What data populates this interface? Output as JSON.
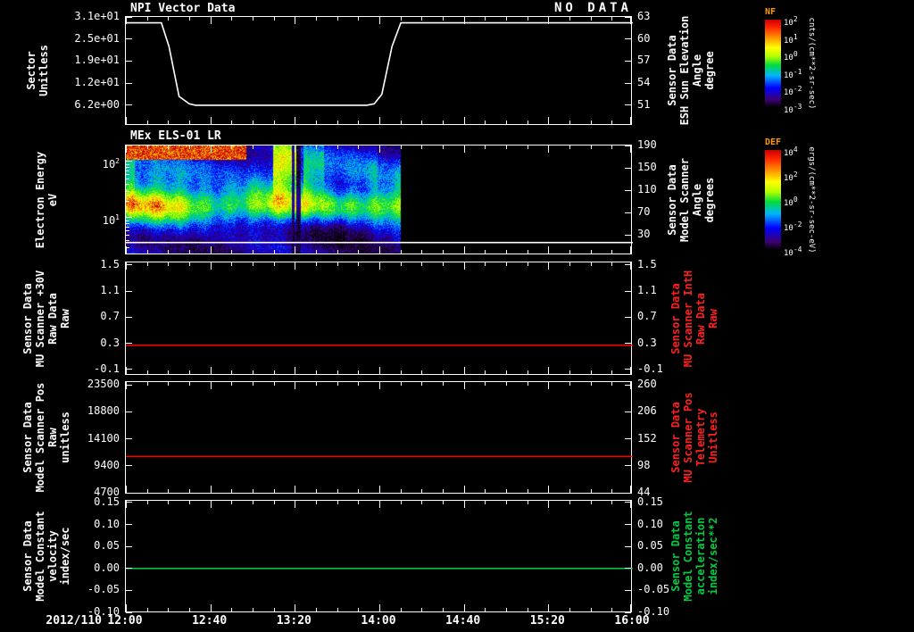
{
  "colors": {
    "background": "#000000",
    "foreground": "#ffffff",
    "line_red": "#ff0000",
    "line_green": "#00c040",
    "right_label_red": "#ff2020",
    "right_label_green": "#00cc44",
    "colorbar_title": "#ff9900"
  },
  "header": {
    "title": "NPI Vector Data",
    "no_data": "NO DATA"
  },
  "panel2_title": "MEx ELS-01 LR",
  "time_axis": {
    "date": "2012/110",
    "start_hour": 12,
    "end_hour": 16,
    "major_labels": [
      "12:00",
      "12:40",
      "13:20",
      "14:00",
      "14:40",
      "15:20",
      "16:00"
    ],
    "minor_step_minutes": 10
  },
  "chart_data": [
    {
      "type": "line",
      "name": "npi-vector-data",
      "title": "NPI Vector Data",
      "status": "NO DATA",
      "axis": {
        "top_value": 63,
        "bottom_value": 48.2
      },
      "left_label_lines": [
        "Sector",
        "Unitless"
      ],
      "left_ticks": [
        {
          "label": "3.1e+01",
          "at": 63
        },
        {
          "label": "2.5e+01",
          "at": 60
        },
        {
          "label": "1.9e+01",
          "at": 57
        },
        {
          "label": "1.2e+01",
          "at": 54
        },
        {
          "label": "6.2e+00",
          "at": 51
        }
      ],
      "right_ticks": [
        {
          "label": "63",
          "at": 63
        },
        {
          "label": "60",
          "at": 60
        },
        {
          "label": "57",
          "at": 57
        },
        {
          "label": "54",
          "at": 54
        },
        {
          "label": "51",
          "at": 51
        }
      ],
      "right_label_lines": [
        "Sensor Data",
        "ESH Sun Elevation",
        "Angle",
        "degree"
      ],
      "right_label_color": "#ffffff",
      "lines": [
        {
          "series": "ESH Sun Elevation Angle (degrees)",
          "color": "#ffffff",
          "points": [
            [
              12.0,
              62.2
            ],
            [
              12.28,
              62.2
            ],
            [
              12.34,
              59.0
            ],
            [
              12.42,
              52.2
            ],
            [
              12.5,
              51.2
            ],
            [
              12.55,
              51.0
            ],
            [
              13.9,
              51.0
            ],
            [
              13.96,
              51.2
            ],
            [
              14.02,
              52.5
            ],
            [
              14.1,
              59.0
            ],
            [
              14.17,
              62.2
            ],
            [
              16.0,
              62.2
            ]
          ]
        }
      ]
    },
    {
      "type": "heatmap",
      "name": "mex-els-01-lr",
      "title": "MEx ELS-01 LR",
      "axis": {
        "top_value": 190,
        "bottom_value": -6.8
      },
      "energy_axis": {
        "top_ev": 193,
        "bottom_ev": 2.15
      },
      "left_label_lines": [
        "Electron Energy",
        "eV"
      ],
      "left_ticks": [
        {
          "label": "10^2",
          "at_energy": 100
        },
        {
          "label": "10^1",
          "at_energy": 10
        }
      ],
      "left_minor_tick_energies": [
        3,
        4,
        5,
        6,
        7,
        8,
        9,
        20,
        30,
        40,
        50,
        60,
        70,
        80,
        90
      ],
      "right_ticks": [
        {
          "label": "190",
          "at": 190
        },
        {
          "label": "150",
          "at": 150
        },
        {
          "label": "110",
          "at": 110
        },
        {
          "label": "70",
          "at": 70
        },
        {
          "label": "30",
          "at": 30
        }
      ],
      "right_label_lines": [
        "Sensor Data",
        "Model Scanner",
        "Angle",
        "degrees"
      ],
      "right_label_color": "#ffffff",
      "lines": [
        {
          "series": "Model Scanner Angle (degrees)",
          "color": "#ffffff",
          "points": [
            [
              12.0,
              16
            ],
            [
              16.0,
              16
            ]
          ]
        }
      ],
      "spectrogram": {
        "description": "ELS low-rate electron energy-flux spectrogram; data ends near 14:10, black afterwards",
        "time_range": [
          12.0,
          14.17
        ],
        "main_band_ev": [
          8,
          40
        ],
        "burst_times": [
          [
            13.16,
            13.34
          ],
          [
            13.4,
            13.56
          ]
        ],
        "dropout_times": [
          [
            13.305,
            13.325
          ],
          [
            13.345,
            13.375
          ]
        ],
        "high_energy_red_edge_time": [
          12.0,
          12.95
        ]
      }
    },
    {
      "type": "line",
      "name": "mu-scanner-30v",
      "axis": {
        "top_value": 1.54,
        "bottom_value": -0.2
      },
      "left_label_lines": [
        "Sensor Data",
        "MU Scanner +30V",
        "Raw Data",
        "Raw"
      ],
      "left_ticks": [
        {
          "label": "1.5",
          "at": 1.5
        },
        {
          "label": "1.1",
          "at": 1.1
        },
        {
          "label": "0.7",
          "at": 0.7
        },
        {
          "label": "0.3",
          "at": 0.3
        },
        {
          "label": "-0.1",
          "at": -0.1
        }
      ],
      "right_ticks": [
        {
          "label": "1.5",
          "at": 1.5
        },
        {
          "label": "1.1",
          "at": 1.1
        },
        {
          "label": "0.7",
          "at": 0.7
        },
        {
          "label": "0.3",
          "at": 0.3
        },
        {
          "label": "-0.1",
          "at": -0.1
        }
      ],
      "right_label_lines": [
        "Sensor Data",
        "MU Scanner IntH",
        "Raw Data",
        "Raw"
      ],
      "right_label_color": "#ff2020",
      "lines": [
        {
          "series": "MU Scanner +30V Raw (constant)",
          "color": "#ff0000",
          "points": [
            [
              12.0,
              0.27
            ],
            [
              16.0,
              0.27
            ]
          ]
        }
      ]
    },
    {
      "type": "line",
      "name": "model-scanner-pos",
      "axis": {
        "top_value": 23970,
        "bottom_value": 4390
      },
      "left_label_lines": [
        "Sensor Data",
        "Model Scanner Pos",
        "Raw",
        "unitless"
      ],
      "left_ticks": [
        {
          "label": "23500",
          "at": 23500
        },
        {
          "label": "18800",
          "at": 18800
        },
        {
          "label": "14100",
          "at": 14100
        },
        {
          "label": "9400",
          "at": 9400
        },
        {
          "label": "4700",
          "at": 4700
        }
      ],
      "right_ticks": [
        {
          "label": "260",
          "at": 23500
        },
        {
          "label": "206",
          "at": 18800
        },
        {
          "label": "152",
          "at": 14100
        },
        {
          "label": "98",
          "at": 9400
        },
        {
          "label": "44",
          "at": 4700
        }
      ],
      "right_label_lines": [
        "Sensor Data",
        "MU Scanner Pos",
        "Telemetry",
        "Unitless"
      ],
      "right_label_color": "#ff2020",
      "lines": [
        {
          "series": "Model Scanner Pos Raw (constant)",
          "color": "#ff0000",
          "points": [
            [
              12.0,
              11000
            ],
            [
              16.0,
              11000
            ]
          ]
        }
      ]
    },
    {
      "type": "line",
      "name": "model-constant-velocity",
      "axis": {
        "top_value": 0.154,
        "bottom_value": -0.102
      },
      "left_label_lines": [
        "Sensor Data",
        "Model Constant",
        "velocity",
        "index/sec"
      ],
      "left_ticks": [
        {
          "label": "0.15",
          "at": 0.15
        },
        {
          "label": "0.10",
          "at": 0.1
        },
        {
          "label": "0.05",
          "at": 0.05
        },
        {
          "label": "0.00",
          "at": 0.0
        },
        {
          "label": "-0.05",
          "at": -0.05
        },
        {
          "label": "-0.10",
          "at": -0.1
        }
      ],
      "right_ticks": [
        {
          "label": "0.15",
          "at": 0.15
        },
        {
          "label": "0.10",
          "at": 0.1
        },
        {
          "label": "0.05",
          "at": 0.05
        },
        {
          "label": "0.00",
          "at": 0.0
        },
        {
          "label": "-0.05",
          "at": -0.05
        },
        {
          "label": "-0.10",
          "at": -0.1
        }
      ],
      "right_label_lines": [
        "Sensor Data",
        "Model Constant",
        "acceleration",
        "index/sec**2"
      ],
      "right_label_color": "#00cc44",
      "lines": [
        {
          "series": "Model Constant velocity (constant)",
          "color": "#00c040",
          "points": [
            [
              12.0,
              0.0
            ],
            [
              16.0,
              0.0
            ]
          ]
        }
      ]
    }
  ],
  "colorbars": [
    {
      "title": "NF",
      "unit": "cnts/(cm**2-sr-sec)",
      "tick_labels": [
        "10^2",
        "10^1",
        "10^0",
        "10^-1",
        "10^-2",
        "10^-3"
      ]
    },
    {
      "title": "DEF",
      "unit": "ergs/(cm**2-sr-sec-eV)",
      "tick_labels": [
        "10^4",
        "10^2",
        "10^0",
        "10^-2",
        "10^-4"
      ]
    }
  ]
}
